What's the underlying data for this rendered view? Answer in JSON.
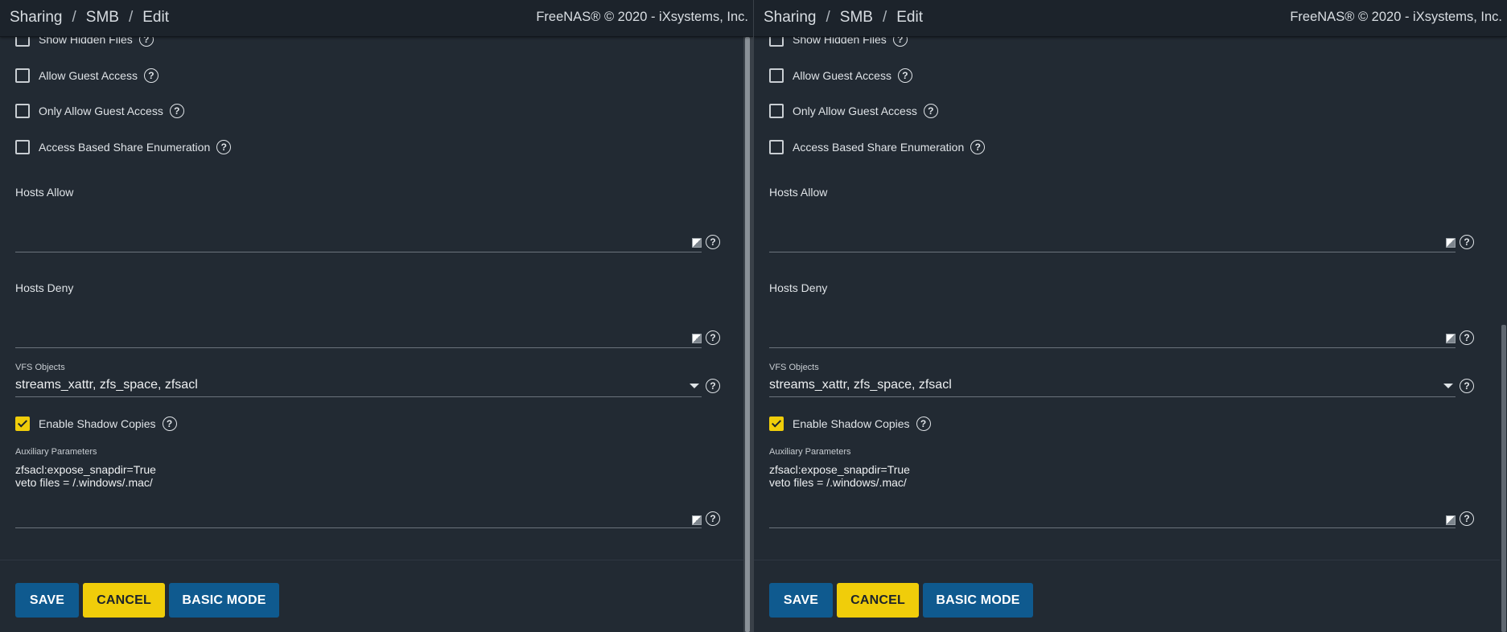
{
  "panes": [
    {
      "breadcrumb": [
        "Sharing",
        "SMB",
        "Edit"
      ],
      "copyright": "FreeNAS® © 2020 - iXsystems, Inc.",
      "checkboxes": {
        "show_hidden_files": {
          "label": "Show Hidden Files",
          "checked": false
        },
        "allow_guest_access": {
          "label": "Allow Guest Access",
          "checked": false
        },
        "only_allow_guest_access": {
          "label": "Only Allow Guest Access",
          "checked": false
        },
        "access_based_share_enumeration": {
          "label": "Access Based Share Enumeration",
          "checked": false
        },
        "enable_shadow_copies": {
          "label": "Enable Shadow Copies",
          "checked": true
        }
      },
      "hosts_allow": {
        "label": "Hosts Allow",
        "value": ""
      },
      "hosts_deny": {
        "label": "Hosts Deny",
        "value": ""
      },
      "vfs_objects": {
        "label": "VFS Objects",
        "value": "streams_xattr, zfs_space, zfsacl"
      },
      "auxiliary_parameters": {
        "label": "Auxiliary Parameters",
        "value": "zfsacl:expose_snapdir=True\nveto files = /.windows/.mac/"
      },
      "buttons": {
        "save": "SAVE",
        "cancel": "CANCEL",
        "basic_mode": "BASIC MODE"
      }
    },
    {
      "breadcrumb": [
        "Sharing",
        "SMB",
        "Edit"
      ],
      "copyright": "FreeNAS® © 2020 - iXsystems, Inc.",
      "checkboxes": {
        "show_hidden_files": {
          "label": "Show Hidden Files",
          "checked": false
        },
        "allow_guest_access": {
          "label": "Allow Guest Access",
          "checked": false
        },
        "only_allow_guest_access": {
          "label": "Only Allow Guest Access",
          "checked": false
        },
        "access_based_share_enumeration": {
          "label": "Access Based Share Enumeration",
          "checked": false
        },
        "enable_shadow_copies": {
          "label": "Enable Shadow Copies",
          "checked": true
        }
      },
      "hosts_allow": {
        "label": "Hosts Allow",
        "value": ""
      },
      "hosts_deny": {
        "label": "Hosts Deny",
        "value": ""
      },
      "vfs_objects": {
        "label": "VFS Objects",
        "value": "streams_xattr, zfs_space, zfsacl"
      },
      "auxiliary_parameters": {
        "label": "Auxiliary Parameters",
        "value": "zfsacl:expose_snapdir=True\nveto files = /.windows/.mac/"
      },
      "buttons": {
        "save": "SAVE",
        "cancel": "CANCEL",
        "basic_mode": "BASIC MODE"
      }
    }
  ],
  "colors": {
    "accent": "#f0cd0a",
    "primary": "#0f5a8f",
    "background": "#222a33",
    "topbar": "#1c232b"
  },
  "icons": {
    "help": "help-circle-icon",
    "resize": "resize-handle-icon",
    "dropdown": "chevron-down-icon",
    "check": "check-icon"
  }
}
